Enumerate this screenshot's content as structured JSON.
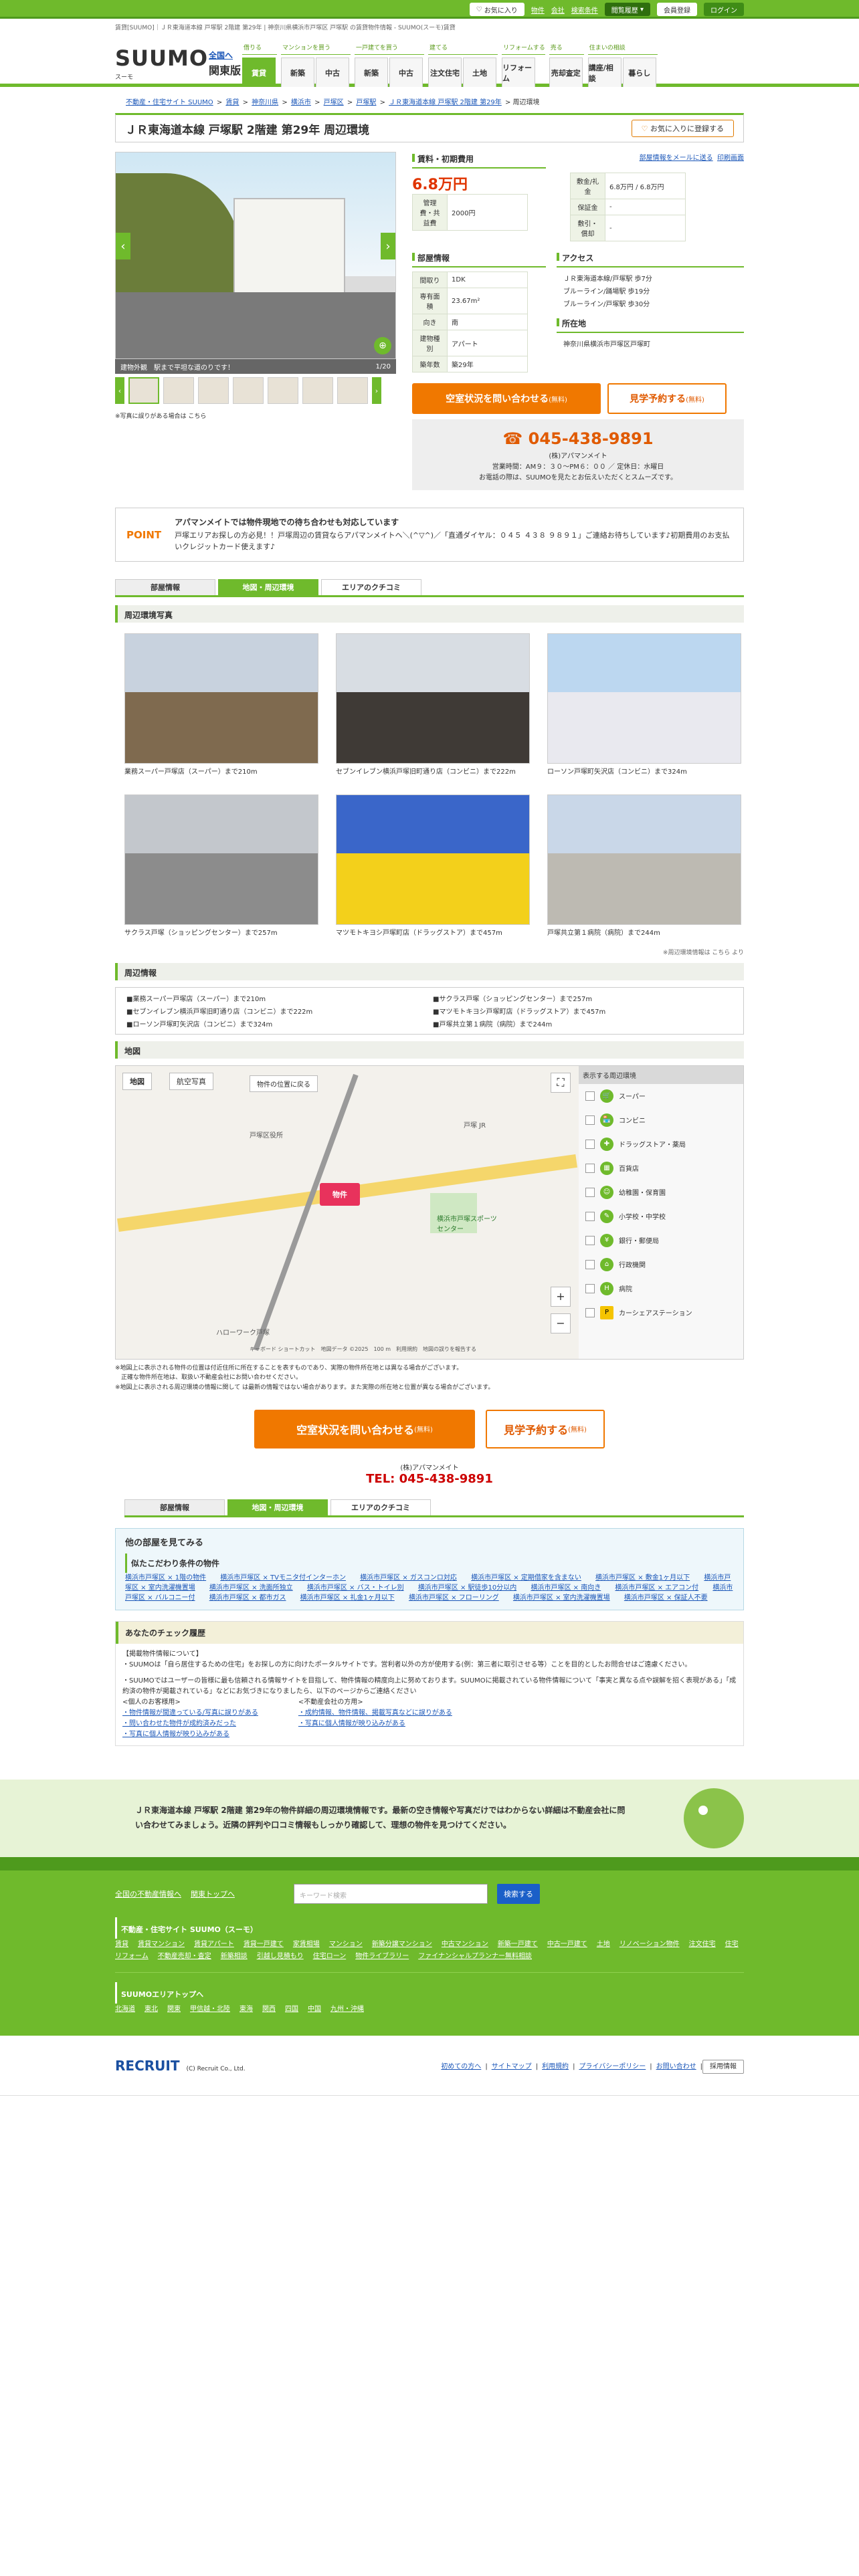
{
  "header": {
    "pill_favorite": "お気に入り",
    "links": [
      "物件",
      "会社",
      "検索条件"
    ],
    "history": "閲覧履歴",
    "register": "会員登録",
    "login": "ログイン"
  },
  "meta": "賃貸[SUUMO]｜ＪＲ東海道本線 戸塚駅 2階建 第29年 | 神奈川県横浜市戸塚区 戸塚駅 の賃貸物件情報 - SUUMO(スーモ)賃貸",
  "logo": {
    "main": "SUUMO",
    "sub": "スーモ",
    "region1": "全国へ",
    "region2": "関東版"
  },
  "gnav": {
    "cats": [
      "借りる",
      "マンションを買う",
      "一戸建てを買う",
      "建てる",
      "リフォームする",
      "売る",
      "住まいの相談"
    ],
    "buttons": [
      "賃貸",
      "新築",
      "中古",
      "新築",
      "中古",
      "注文住宅",
      "土地",
      "リフォーム",
      "売却査定",
      "講座/相談",
      "暮らし"
    ]
  },
  "breadcrumb": [
    "不動産・住宅サイト SUUMO",
    "賃貸",
    "神奈川県",
    "横浜市",
    "戸塚区",
    "戸塚駅",
    "ＪＲ東海道本線 戸塚駅 2階建 第29年",
    "周辺環境"
  ],
  "title": "ＪＲ東海道本線 戸塚駅 2階建 第29年 周辺環境",
  "fav_button": "お気に入りに登録する",
  "mail_link": "部屋情報をメールに送る",
  "print_link": "印刷画面",
  "gallery": {
    "caption": "建物外観　駅まで平坦な道のりです！",
    "counter": "1/20",
    "note": "※写真に誤りがある場合は こちら"
  },
  "fee": {
    "heading": "賃料・初期費用",
    "rent": "6.8万円",
    "mgmt_label": "管理費・共益費",
    "mgmt": "2000円",
    "rows": [
      [
        "敷金/礼金",
        "6.8万円 / 6.8万円"
      ],
      [
        "保証金",
        "-"
      ],
      [
        "敷引・償却",
        "-"
      ]
    ]
  },
  "room": {
    "heading": "部屋情報",
    "rows": [
      [
        "間取り",
        "1DK"
      ],
      [
        "専有面積",
        "23.67m²"
      ],
      [
        "向き",
        "南"
      ],
      [
        "建物種別",
        "アパート"
      ],
      [
        "築年数",
        "築29年"
      ]
    ]
  },
  "access": {
    "heading": "アクセス",
    "lines": [
      "ＪＲ東海道本線/戸塚駅 歩7分",
      "ブルーライン/踊場駅 歩19分",
      "ブルーライン/戸塚駅 歩30分"
    ],
    "addr_heading": "所在地",
    "addr": "神奈川県横浜市戸塚区戸塚町"
  },
  "cta": {
    "inquiry": "空室状況を問い合わせる",
    "inquiry_sub": "(無料)",
    "visit": "見学予約する",
    "visit_sub": "(無料)"
  },
  "tel": {
    "number": "045-438-9891",
    "company": "(株)アパマンメイト",
    "hours": "営業時間：AM９：３０〜PM６：００ ／ 定休日：水曜日",
    "note": "お電話の際は、SUUMOを見たとお伝えいただくとスムーズです。"
  },
  "point": {
    "label": "POINT",
    "title": "アパマンメイトでは物件現地での待ち合わせも対応しています",
    "body": "戸塚エリアお探しの方必見！！戸塚周辺の賃貸ならアパマンメイトへ＼(^▽^)／「直通ダイヤル：０４５ ４３８ ９８９１」ご連絡お待ちしています♪初期費用のお支払いクレジットカード使えます♪"
  },
  "tabs": [
    "部屋情報",
    "地図・周辺環境",
    "エリアのクチコミ"
  ],
  "photos_heading": "周辺環境写真",
  "photos": [
    {
      "cap": "業務スーパー戸塚店（スーパー）まで210m",
      "c1": "#c8d2de",
      "c2": "#7f6a4f"
    },
    {
      "cap": "セブンイレブン横浜戸塚旧町通り店（コンビニ）まで222m",
      "c1": "#d8dde3",
      "c2": "#3f3a36"
    },
    {
      "cap": "ローソン戸塚町矢沢店（コンビニ）まで324m",
      "c1": "#bcd7f0",
      "c2": "#e9e9ef"
    },
    {
      "cap": "サクラス戸塚（ショッピングセンター）まで257m",
      "c1": "#c3c7cc",
      "c2": "#8c8c8c"
    },
    {
      "cap": "マツモトキヨシ戸塚町店（ドラッグストア）まで457m",
      "c1": "#3a66c9",
      "c2": "#f3d01b"
    },
    {
      "cap": "戸塚共立第１病院（病院）まで244m",
      "c1": "#c9d7e8",
      "c2": "#bdbab2"
    }
  ],
  "credit": "※周辺環境情報は こちら より",
  "surround_heading": "周辺情報",
  "surround": [
    "業務スーパー戸塚店（スーパー）まで210m",
    "サクラス戸塚（ショッピングセンター）まで257m",
    "セブンイレブン横浜戸塚旧町通り店（コンビニ）まで222m",
    "マツモトキヨシ戸塚町店（ドラッグストア）まで457m",
    "ローソン戸塚町矢沢店（コンビニ）まで324m",
    "戸塚共立第１病院（病院）まで244m"
  ],
  "map_heading": "地図",
  "map": {
    "btn_map": "地図",
    "btn_photo": "航空写真",
    "btn_loc": "物件の位置に戻る",
    "pin": "物件",
    "labels": [
      "戸塚 JR",
      "横浜市戸塚スポーツセンター",
      "ハローワーク戸塚",
      "戸塚区役所"
    ],
    "footer": "キーボード ショートカット　地図データ ©2025　100 m　利用規約　地図の誤りを報告する"
  },
  "map_side": {
    "heading": "表示する周辺環境",
    "items": [
      "スーパー",
      "コンビニ",
      "ドラッグストア・薬局",
      "百貨店",
      "幼稚園・保育園",
      "小学校・中学校",
      "銀行・郵便局",
      "行政機関",
      "病院",
      "カーシェアステーション"
    ]
  },
  "map_notes": [
    "※地図上に表示される物件の位置は付近住所に所在することを表すものであり、実際の物件所在地とは異なる場合がございます。",
    "　正確な物件所在地は、取扱い不動産会社にお問い合わせください。",
    "※地図上に表示される周辺環境の情報に関して は最新の情報ではない場合があります。また実際の所在地と位置が異なる場合がございます。"
  ],
  "other": {
    "heading": "他の部屋を見てみる",
    "sub": "似たこだわり条件の物件",
    "links": [
      "横浜市戸塚区 × 1階の物件",
      "横浜市戸塚区 × TVモニタ付インターホン",
      "横浜市戸塚区 × ガスコンロ対応",
      "横浜市戸塚区 × 定期借家を含まない",
      "横浜市戸塚区 × 敷金1ヶ月以下",
      "横浜市戸塚区 × 室内洗濯機置場",
      "横浜市戸塚区 × 洗面所独立",
      "横浜市戸塚区 × バス・トイレ別",
      "横浜市戸塚区 × 駅徒歩10分以内",
      "横浜市戸塚区 × 南向き",
      "横浜市戸塚区 × エアコン付",
      "横浜市戸塚区 × バルコニー付",
      "横浜市戸塚区 × 都市ガス",
      "横浜市戸塚区 × 礼金1ヶ月以下",
      "横浜市戸塚区 × フローリング",
      "横浜市戸塚区 × 室内洗濯機置場",
      "横浜市戸塚区 × 保証人不要"
    ]
  },
  "check": {
    "heading": "あなたのチェック履歴",
    "lead": "【掲載物件情報について】",
    "p1": "・SUUMOは「自ら居住するための住宅」をお探しの方に向けたポータルサイトです。営利者以外の方が使用する(例：第三者に取引させる等）ことを目的としたお問合せはご遠慮ください。",
    "p2": "・SUUMOではユーザーの皆様に最も信頼される情報サイトを目指して、物件情報の精度向上に努めております。SUUMOに掲載されている物件情報について「事実と異なる点や誤解を招く表現がある」「成約済の物件が掲載されている」などにお気づきになりましたら、以下のページからご連絡ください",
    "col1": [
      "<個人のお客様用>",
      "・物件情報が間違っている/写真に誤りがある",
      "・問い合わせた物件が成約済みだった",
      "・写真に個人情報が映り込みがある"
    ],
    "col2": [
      "<不動産会社の方用>",
      "・成約情報、物件情報、掲載写真などに誤りがある",
      "・写真に個人情報が映り込みがある"
    ]
  },
  "banner": "ＪＲ東海道本線 戸塚駅 2階建 第29年の物件詳細の周辺環境情報です。最新の空き情報や写真だけではわからない詳細は不動産会社に問い合わせてみましょう。近隣の評判や口コミ情報もしっかり確認して、理想の物件を見つけてください。",
  "footer": {
    "l1": "全国の不動産情報へ",
    "l2": "関東トップへ",
    "search_placeholder": "キーワード検索",
    "search_btn": "検索する",
    "h1": "不動産・住宅サイト SUUMO（スーモ）",
    "links1": [
      "賃貸",
      "賃貸マンション",
      "賃貸アパート",
      "賃貸一戸建て",
      "家賃相場",
      "マンション",
      "新築分譲マンション",
      "中古マンション",
      "新築一戸建て",
      "中古一戸建て",
      "土地",
      "リノベーション物件",
      "注文住宅",
      "住宅リフォーム",
      "不動産売却・査定",
      "新築相談",
      "引越し見積もり",
      "住宅ローン",
      "物件ライブラリー",
      "ファイナンシャルプランナー無料相談"
    ],
    "h2": "SUUMOエリアトップへ",
    "links2": [
      "北海道",
      "東北",
      "関東",
      "甲信越・北陸",
      "東海",
      "関西",
      "四国",
      "中国",
      "九州・沖縄"
    ]
  },
  "bottom": {
    "brand": "RECRUIT",
    "copy": "(C) Recruit Co., Ltd.",
    "links": [
      "初めての方へ",
      "サイトマップ",
      "利用規約",
      "プライバシーポリシー",
      "お問い合わせ"
    ],
    "biz": "採用情報"
  }
}
